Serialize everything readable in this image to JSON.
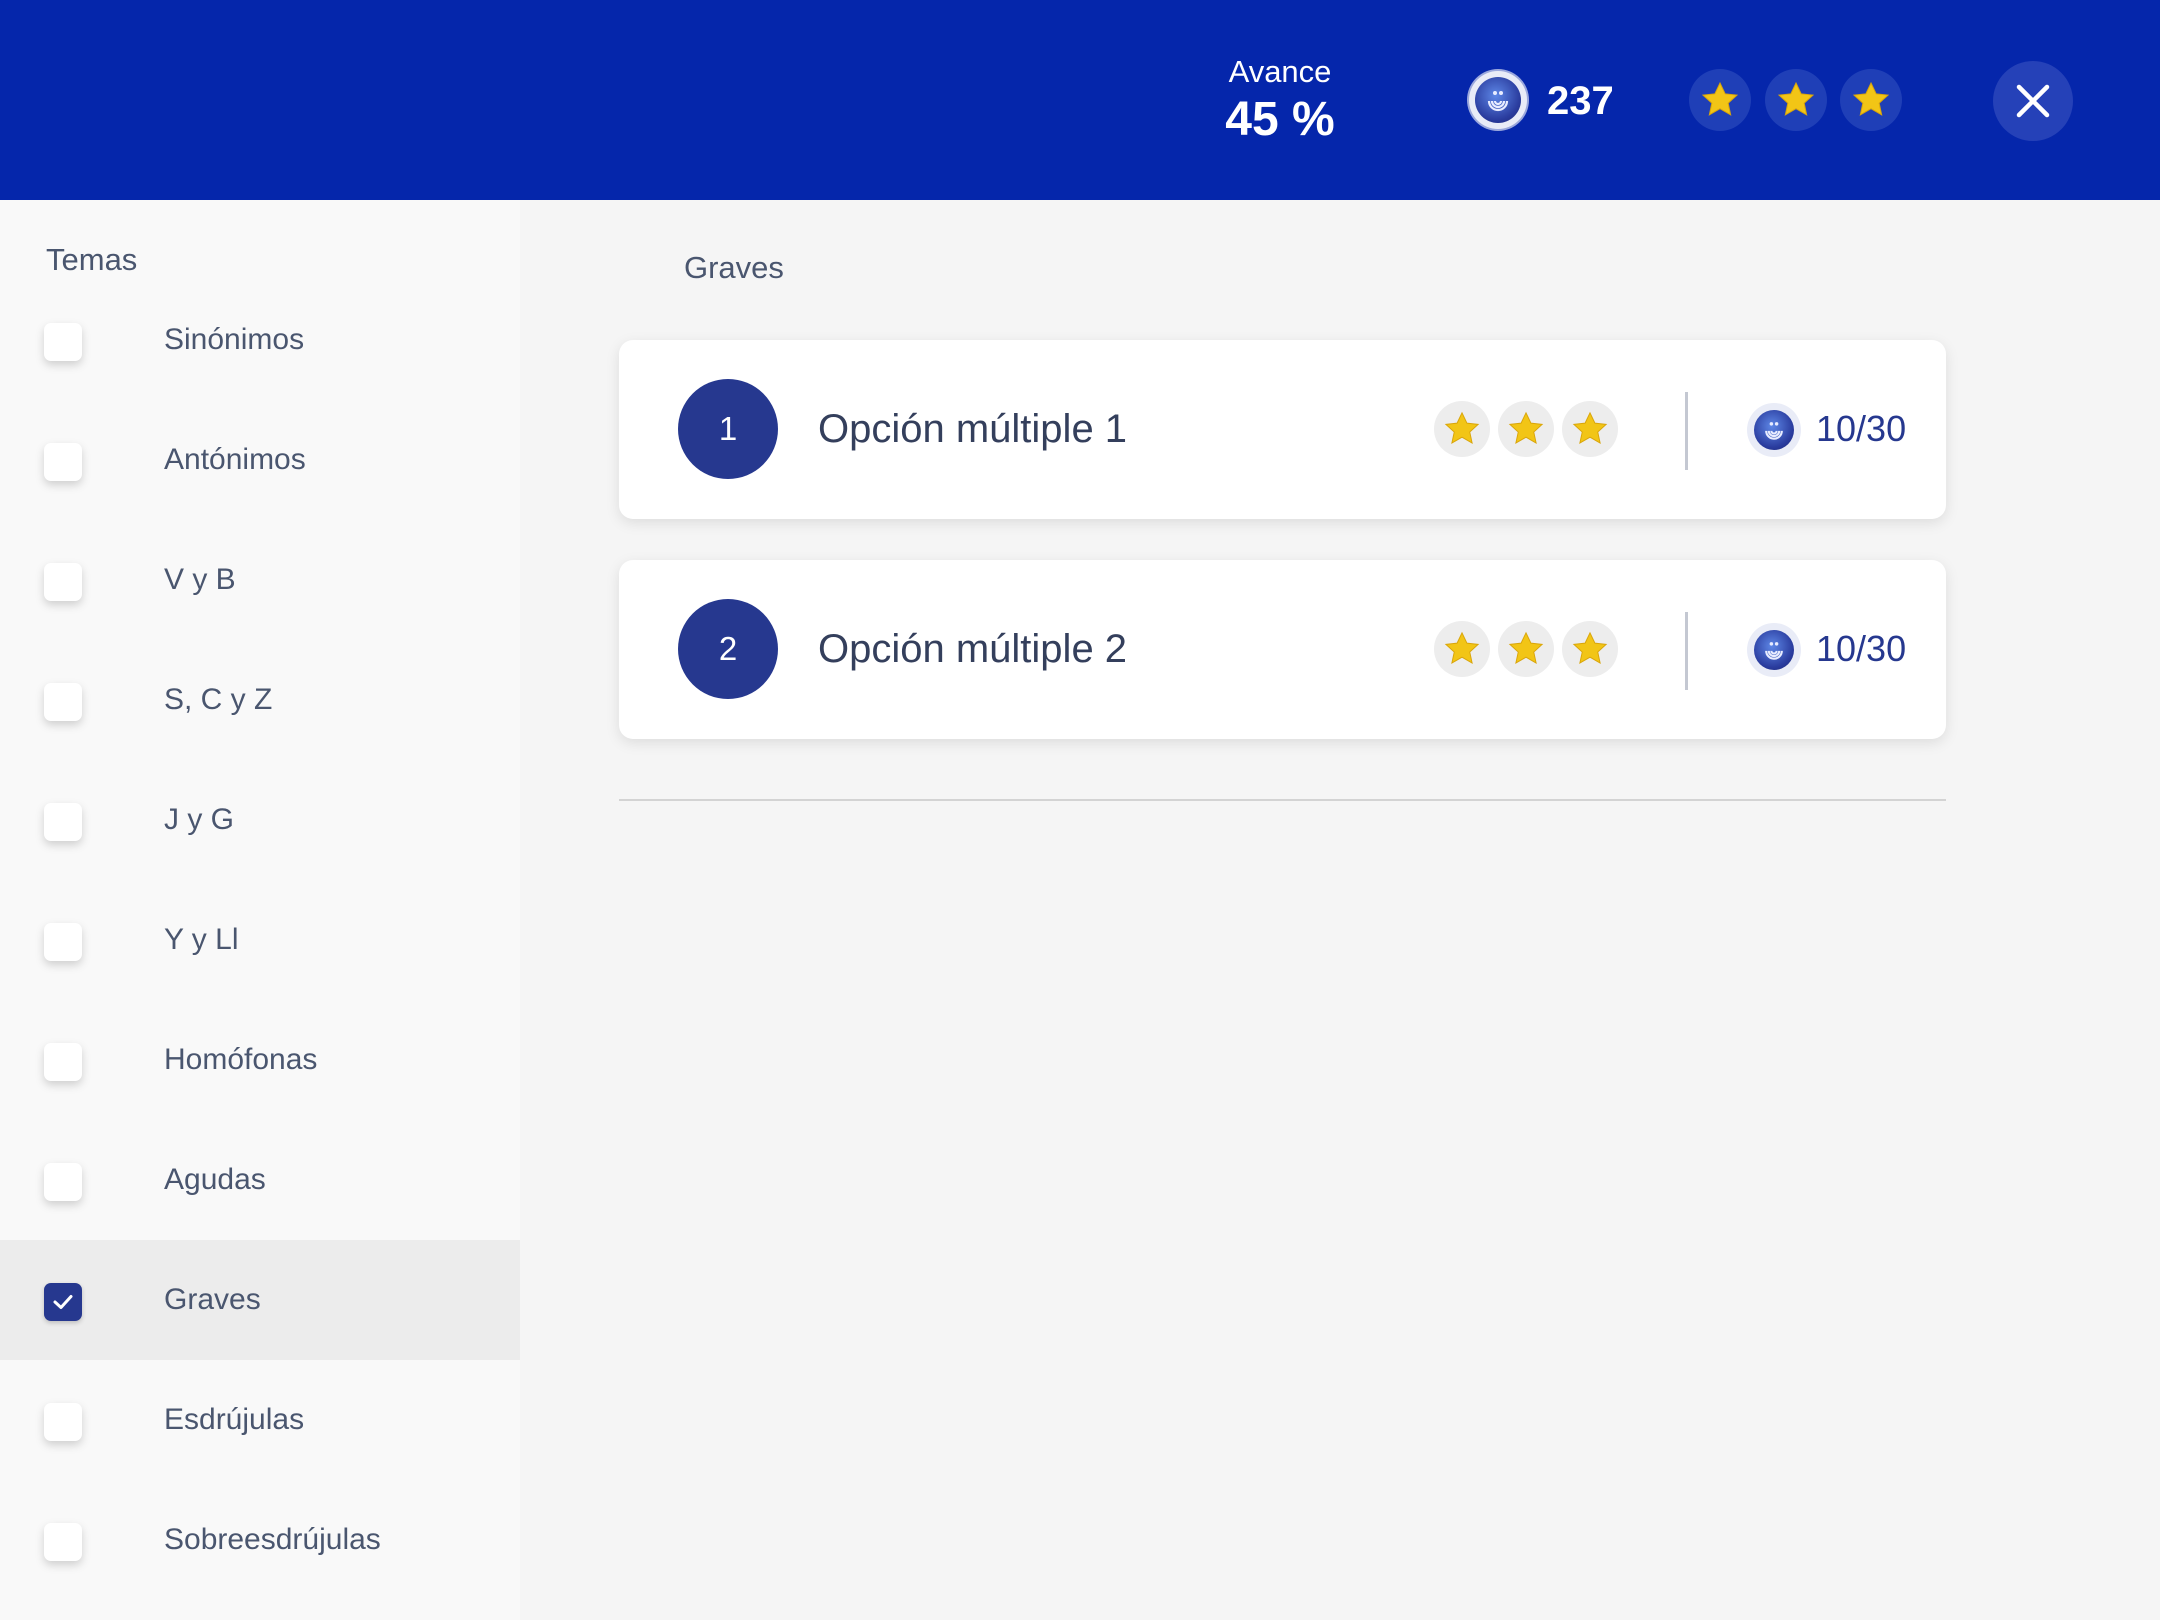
{
  "colors": {
    "header_bg": "#0526ab",
    "accent": "#26388f",
    "star": "#f2c516",
    "text": "#4a566f"
  },
  "header": {
    "progress_label": "Avance",
    "progress_value": "45 %",
    "progress_percent": 45,
    "coins": "237",
    "stars_earned": 3,
    "close_icon": "close-icon"
  },
  "sidebar": {
    "title": "Temas",
    "items": [
      {
        "label": "Sinónimos",
        "checked": false
      },
      {
        "label": "Antónimos",
        "checked": false
      },
      {
        "label": "V y B",
        "checked": false
      },
      {
        "label": "S, C y Z",
        "checked": false
      },
      {
        "label": "J y G",
        "checked": false
      },
      {
        "label": "Y y Ll",
        "checked": false
      },
      {
        "label": "Homófonas",
        "checked": false
      },
      {
        "label": "Agudas",
        "checked": false
      },
      {
        "label": "Graves",
        "checked": true
      },
      {
        "label": "Esdrújulas",
        "checked": false
      },
      {
        "label": "Sobreesdrújulas",
        "checked": false
      }
    ]
  },
  "main": {
    "section_title": "Graves",
    "activities": [
      {
        "number": "1",
        "title": "Opción múltiple 1",
        "stars": 3,
        "score": "10/30"
      },
      {
        "number": "2",
        "title": "Opción múltiple 2",
        "stars": 3,
        "score": "10/30"
      }
    ]
  }
}
